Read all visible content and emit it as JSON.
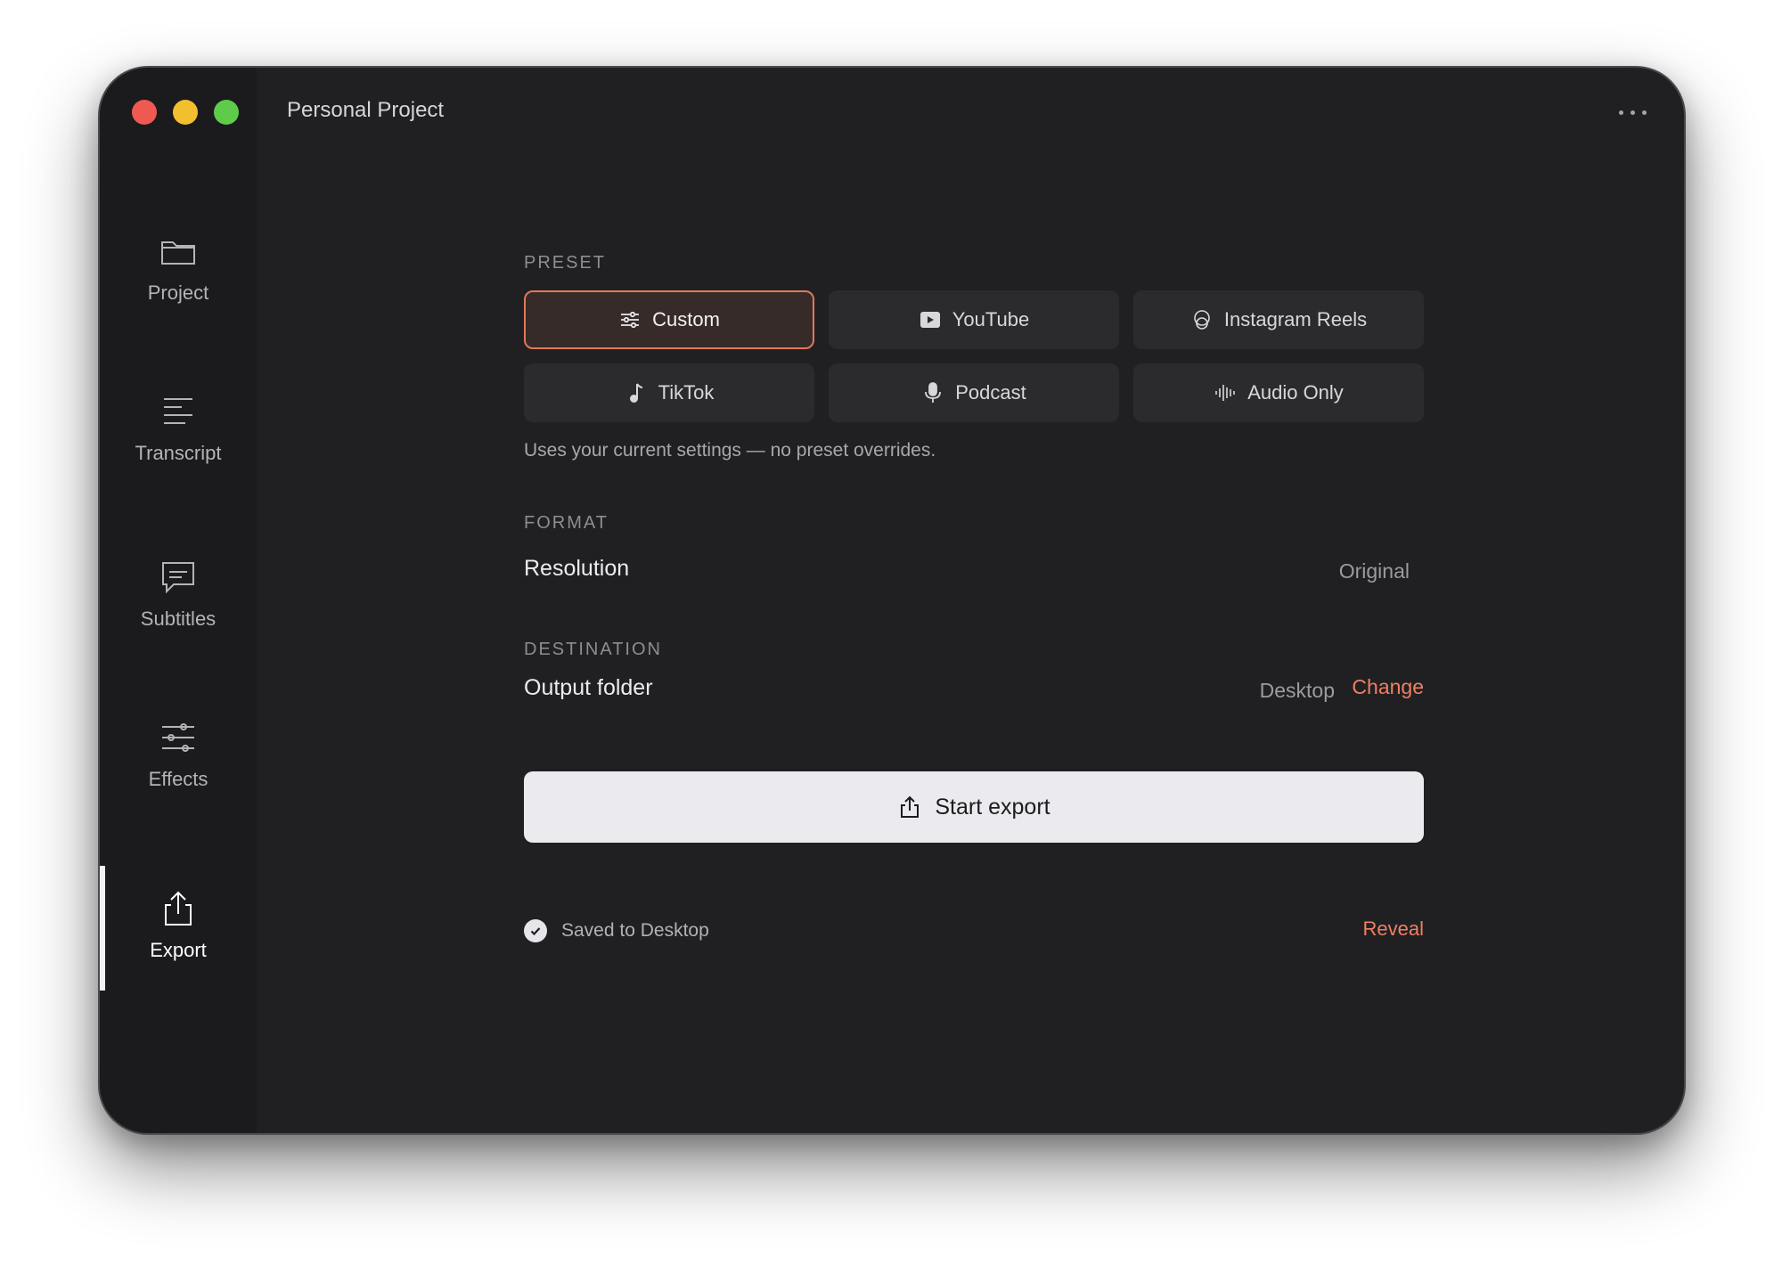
{
  "window": {
    "title": "Personal Project"
  },
  "sidebar": {
    "items": [
      {
        "label": "Project",
        "icon": "folder-icon"
      },
      {
        "label": "Transcript",
        "icon": "transcript-lines-icon"
      },
      {
        "label": "Subtitles",
        "icon": "subtitles-bubble-icon"
      },
      {
        "label": "Effects",
        "icon": "sliders-icon"
      },
      {
        "label": "Export",
        "icon": "share-upload-icon",
        "active": true
      }
    ]
  },
  "preset": {
    "section_label": "PRESET",
    "options": [
      {
        "label": "Custom",
        "icon": "sliders-icon",
        "selected": true
      },
      {
        "label": "YouTube",
        "icon": "youtube-play-icon"
      },
      {
        "label": "Instagram Reels",
        "icon": "reels-icon"
      },
      {
        "label": "TikTok",
        "icon": "music-note-icon"
      },
      {
        "label": "Podcast",
        "icon": "microphone-icon"
      },
      {
        "label": "Audio Only",
        "icon": "waveform-icon"
      }
    ],
    "hint": "Uses your current settings — no preset overrides."
  },
  "format": {
    "section_label": "FORMAT",
    "resolution_label": "Resolution",
    "resolution_value": "Original"
  },
  "destination": {
    "section_label": "DESTINATION",
    "folder_label": "Output folder",
    "folder_value": "Desktop",
    "change_label": "Change"
  },
  "export": {
    "button_label": "Start export"
  },
  "status": {
    "text": "Saved to Desktop",
    "reveal_label": "Reveal"
  },
  "colors": {
    "accent": "#ef7f62",
    "background": "#202022",
    "sidebar": "#1b1b1d"
  }
}
